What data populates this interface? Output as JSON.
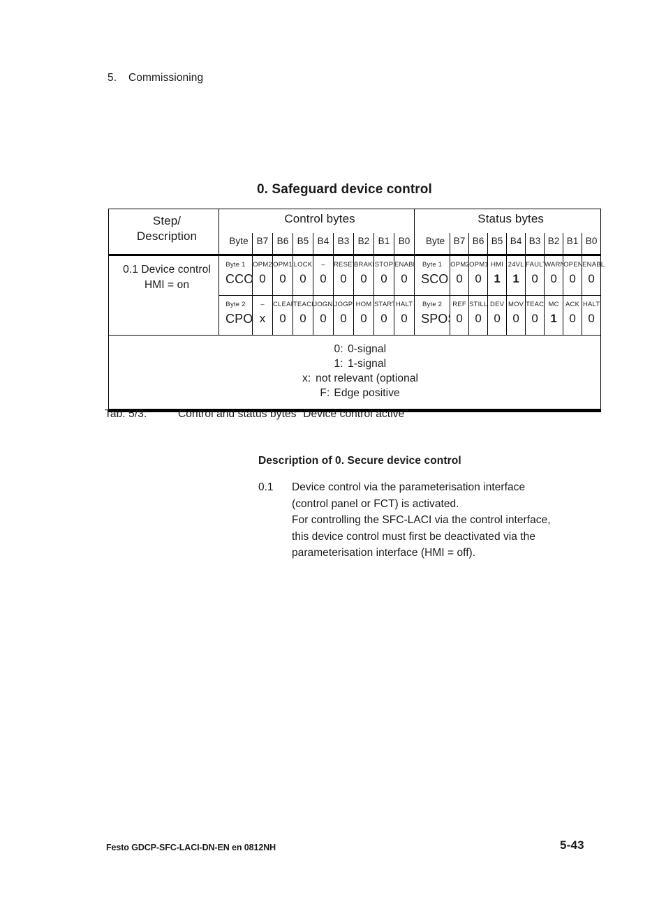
{
  "page": {
    "running_head_number": "5.",
    "running_head_title": "Commissioning",
    "footer_left": "Festo GDCP-SFC-LACI-DN-EN  en 0812NH",
    "footer_page": "5-43"
  },
  "table": {
    "title": "0. Safeguard device control",
    "header": {
      "step_description": "Step/\nDescription",
      "step_line1": "Step/",
      "step_line2": "Description",
      "control_group": "Control bytes",
      "status_group": "Status bytes",
      "byte_col": "Byte",
      "bits": [
        "B7",
        "B6",
        "B5",
        "B4",
        "B3",
        "B2",
        "B1",
        "B0"
      ]
    },
    "step": {
      "line1": "0.1 Device control",
      "line2": "HMI = on"
    },
    "rows": [
      {
        "control": {
          "byte_label": "Byte 1",
          "name": "CCON",
          "bit_names": [
            "OPM2",
            "OPM1",
            "LOCK",
            "–",
            "RESET",
            "BRAKE",
            "STOP",
            "ENABL"
          ],
          "values": [
            "0",
            "0",
            "0",
            "0",
            "0",
            "0",
            "0",
            "0"
          ],
          "bold": [
            false,
            false,
            false,
            false,
            false,
            false,
            false,
            false
          ]
        },
        "status": {
          "byte_label": "Byte 1",
          "name": "SCON",
          "bit_names": [
            "OPM2",
            "OPM1",
            "HMI",
            "24VL",
            "FAULT",
            "WARN",
            "OPEN",
            "ENABL"
          ],
          "values": [
            "0",
            "0",
            "1",
            "1",
            "0",
            "0",
            "0",
            "0"
          ],
          "bold": [
            false,
            false,
            true,
            true,
            false,
            false,
            false,
            false
          ]
        }
      },
      {
        "control": {
          "byte_label": "Byte 2",
          "name": "CPOS",
          "bit_names": [
            "–",
            "CLEAR",
            "TEACH",
            "JOGN",
            "JOGP",
            "HOM",
            "START",
            "HALT"
          ],
          "values": [
            "x",
            "0",
            "0",
            "0",
            "0",
            "0",
            "0",
            "0"
          ],
          "bold": [
            false,
            false,
            false,
            false,
            false,
            false,
            false,
            false
          ]
        },
        "status": {
          "byte_label": "Byte 2",
          "name": "SPOS",
          "bit_names": [
            "REF",
            "STILL",
            "DEV",
            "MOV",
            "TEACH",
            "MC",
            "ACK",
            "HALT"
          ],
          "values": [
            "0",
            "0",
            "0",
            "0",
            "0",
            "1",
            "0",
            "0"
          ],
          "bold": [
            false,
            false,
            false,
            false,
            false,
            true,
            false,
            false
          ]
        }
      }
    ],
    "legend": [
      {
        "key": "0:",
        "text": "0-signal"
      },
      {
        "key": "1:",
        "text": "1-signal"
      },
      {
        "key": "x:",
        "text": "not relevant (optional"
      },
      {
        "key": "F:",
        "text": "Edge positive"
      }
    ]
  },
  "caption": {
    "label": "Tab. 5/3:",
    "text": "Control and status bytes “Device control active”"
  },
  "description": {
    "heading": "Description of 0. Secure device control",
    "item_number": "0.1",
    "lines": [
      "Device control via the parameterisation interface",
      "(control panel or FCT) is activated.",
      "For controlling the SFC-LACI via the control interface,",
      "this device control must first be deactivated via the",
      "parameterisation interface (HMI = off)."
    ]
  }
}
